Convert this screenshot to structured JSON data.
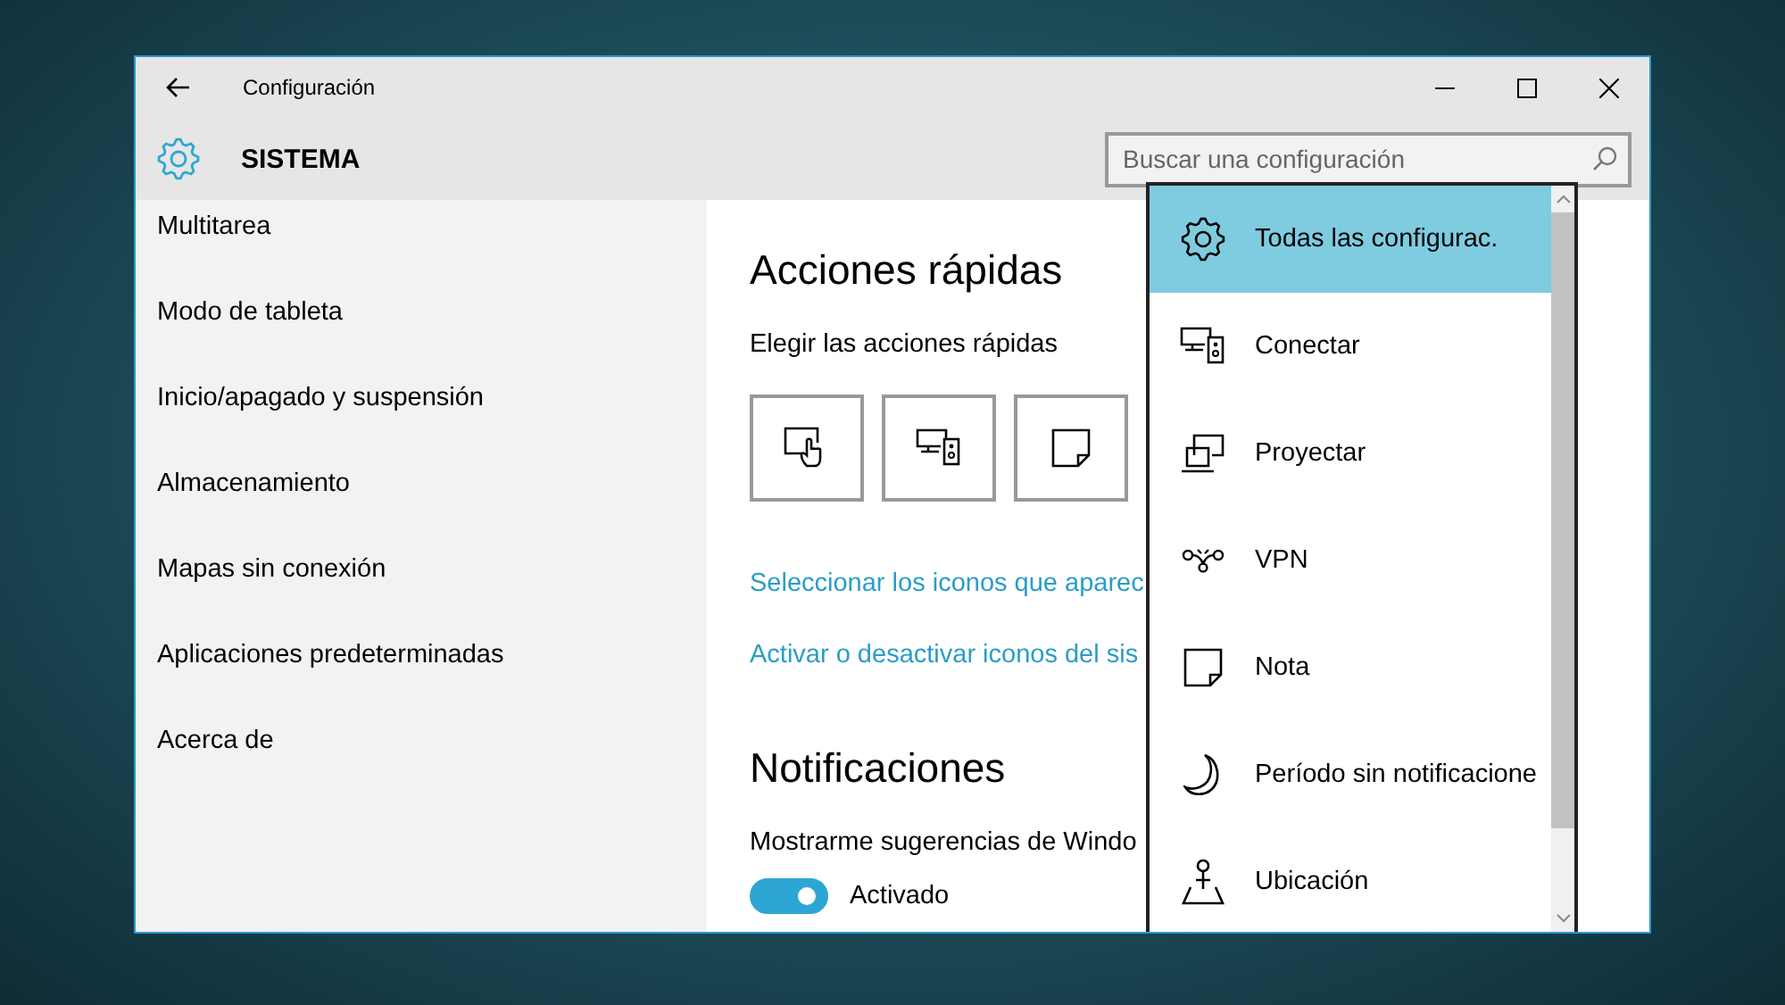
{
  "window": {
    "title": "Configuración"
  },
  "header": {
    "title": "SISTEMA"
  },
  "search": {
    "placeholder": "Buscar una configuración"
  },
  "sidebar": {
    "items": [
      {
        "label": "Multitarea"
      },
      {
        "label": "Modo de tableta"
      },
      {
        "label": "Inicio/apagado y suspensión"
      },
      {
        "label": "Almacenamiento"
      },
      {
        "label": "Mapas sin conexión"
      },
      {
        "label": "Aplicaciones predeterminadas"
      },
      {
        "label": "Acerca de"
      }
    ]
  },
  "content": {
    "quick_actions_title": "Acciones rápidas",
    "quick_actions_label": "Elegir las acciones rápidas",
    "links": [
      "Seleccionar los iconos que aparec",
      "Activar o desactivar iconos del sis"
    ],
    "notifications_title": "Notificaciones",
    "tips_label": "Mostrarme sugerencias de Windo",
    "toggle": {
      "on": true,
      "label": "Activado"
    }
  },
  "dropdown": {
    "items": [
      {
        "label": "Todas las configurac.",
        "selected": true
      },
      {
        "label": "Conectar",
        "selected": false
      },
      {
        "label": "Proyectar",
        "selected": false
      },
      {
        "label": "VPN",
        "selected": false
      },
      {
        "label": "Nota",
        "selected": false
      },
      {
        "label": "Período sin notificacione",
        "selected": false
      },
      {
        "label": "Ubicación",
        "selected": false
      }
    ]
  }
}
